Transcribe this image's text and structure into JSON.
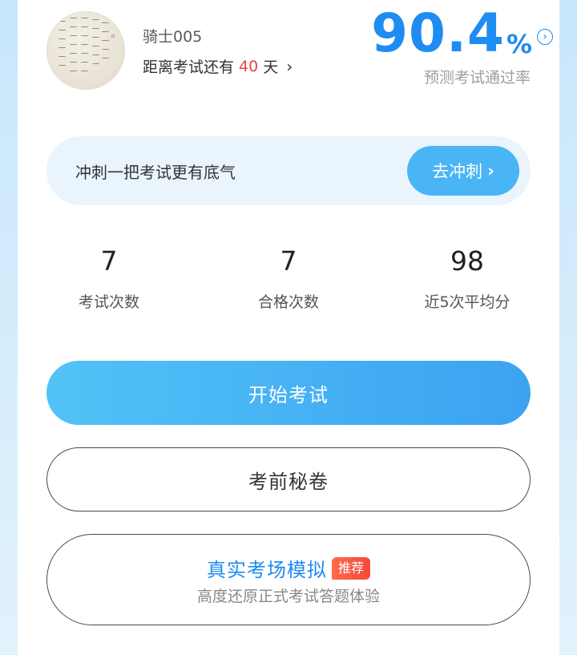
{
  "profile": {
    "username": "骑士005",
    "countdown_prefix": "距离考试还有",
    "countdown_days": "40",
    "countdown_suffix": "天",
    "chevron": "›"
  },
  "pass_rate": {
    "value": "90.4",
    "unit": "%",
    "label": "预测考试通过率",
    "arrow": "›",
    "color": "#1e8cf0"
  },
  "sprint": {
    "text": "冲刺一把考试更有底气",
    "button_label": "去冲刺",
    "button_chevron": "›",
    "color": "#4ab5f5"
  },
  "stats": [
    {
      "value": "7",
      "label": "考试次数"
    },
    {
      "value": "7",
      "label": "合格次数"
    },
    {
      "value": "98",
      "label": "近5次平均分"
    }
  ],
  "actions": {
    "start_label": "开始考试",
    "secret_label": "考前秘卷",
    "mock_title": "真实考场模拟",
    "mock_badge": "推荐",
    "mock_subtitle": "高度还原正式考试答题体验"
  },
  "icons": {
    "avatar": "calligraphy-avatar-image",
    "countdown_chevron": "chevron-right-icon",
    "rate_arrow": "circle-chevron-right-icon",
    "sprint_chevron": "chevron-right-icon"
  },
  "colors": {
    "days_highlight": "#e8463c",
    "badge": "#f44a3a",
    "start_gradient_start": "#52c3f7",
    "start_gradient_end": "#3ba2f1"
  }
}
